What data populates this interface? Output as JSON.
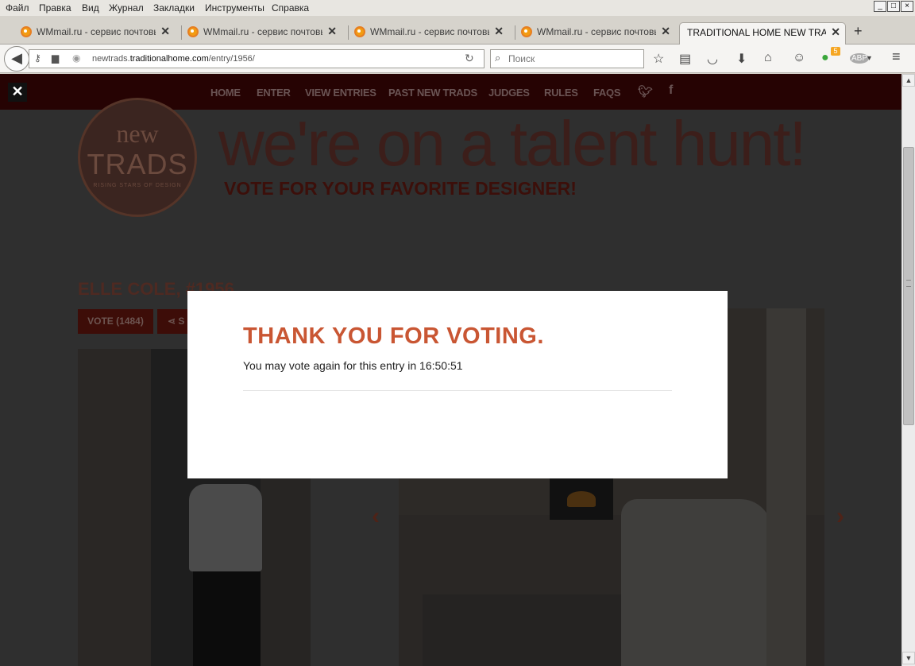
{
  "menu": {
    "items": [
      "Файл",
      "Правка",
      "Вид",
      "Журнал",
      "Закладки",
      "Инструменты",
      "Справка"
    ]
  },
  "window_controls": {
    "minimize": "_",
    "maximize": "□",
    "close": "×"
  },
  "tabs": [
    {
      "title": "WMmail.ru - сервис почтовы..."
    },
    {
      "title": "WMmail.ru - сервис почтовы..."
    },
    {
      "title": "WMmail.ru - сервис почтовы..."
    },
    {
      "title": "WMmail.ru - сервис почтовы..."
    },
    {
      "title": "TRADITIONAL HOME NEW TRADS"
    }
  ],
  "new_tab": "+",
  "nav": {
    "url_prefix": "newtrads.",
    "url_domain": "traditionalhome.com",
    "url_path": "/entry/1956/",
    "search_placeholder": "Поиск",
    "badge_count": "5",
    "abp_label": "ABP"
  },
  "site": {
    "nav_items": [
      "HOME",
      "ENTER",
      "VIEW ENTRIES",
      "PAST NEW TRADS",
      "JUDGES",
      "RULES",
      "FAQS"
    ],
    "close_glyph": "✕",
    "logo_line1": "new",
    "logo_line2": "TRADS",
    "logo_line3": "RISING STARS OF DESIGN",
    "headline": "we're on a talent hunt!",
    "subheadline": "VOTE FOR YOUR FAVORITE DESIGNER!",
    "entry_title": "ELLE COLE, #1956",
    "vote_button": "VOTE (1484)",
    "share_button": "S"
  },
  "modal": {
    "title": "THANK YOU FOR VOTING.",
    "message": "You may vote again for this entry in 16:50:51"
  },
  "colors": {
    "accent": "#c95633",
    "site_nav_bg": "#260303",
    "overlay": "#2f2f2f"
  }
}
